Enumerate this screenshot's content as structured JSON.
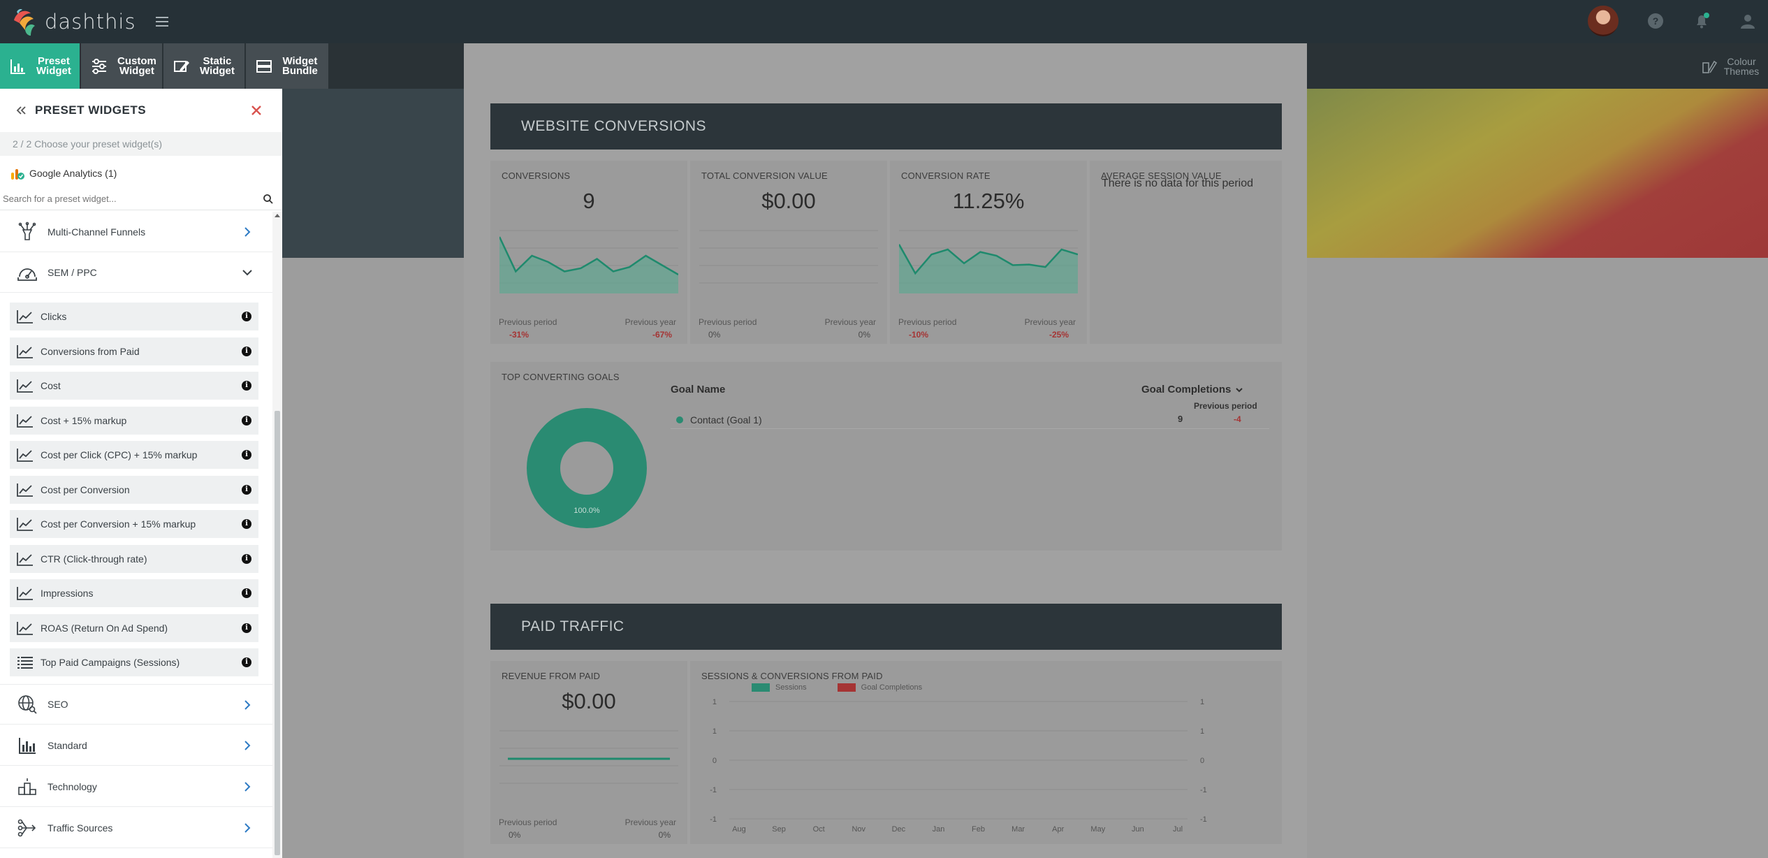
{
  "app": {
    "logo_text": "dashthis"
  },
  "toolbar": {
    "preset": {
      "line1": "Preset",
      "line2": "Widget"
    },
    "custom": {
      "line1": "Custom",
      "line2": "Widget"
    },
    "static": {
      "line1": "Static",
      "line2": "Widget"
    },
    "bundle": {
      "line1": "Widget",
      "line2": "Bundle"
    },
    "colour": {
      "line1": "Colour",
      "line2": "Themes"
    }
  },
  "panel": {
    "title": "PRESET WIDGETS",
    "step": "2 / 2   Choose your preset widget(s)",
    "source": "Google Analytics (1)",
    "search_placeholder": "Search for a preset widget...",
    "categories_top": [
      {
        "label": "Multi-Channel Funnels",
        "icon": "funnel-icon",
        "expanded": false
      },
      {
        "label": "SEM / PPC",
        "icon": "speedometer-icon",
        "expanded": true
      }
    ],
    "items": [
      {
        "label": "Clicks",
        "icon": "line-chart-icon"
      },
      {
        "label": "Conversions from Paid",
        "icon": "line-chart-icon"
      },
      {
        "label": "Cost",
        "icon": "line-chart-icon"
      },
      {
        "label": "Cost + 15% markup",
        "icon": "line-chart-icon"
      },
      {
        "label": "Cost per Click (CPC) + 15% markup",
        "icon": "line-chart-icon"
      },
      {
        "label": "Cost per Conversion",
        "icon": "line-chart-icon"
      },
      {
        "label": "Cost per Conversion + 15% markup",
        "icon": "line-chart-icon"
      },
      {
        "label": "CTR (Click-through rate)",
        "icon": "line-chart-icon"
      },
      {
        "label": "Impressions",
        "icon": "line-chart-icon"
      },
      {
        "label": "ROAS (Return On Ad Spend)",
        "icon": "line-chart-icon"
      },
      {
        "label": "Top Paid Campaigns (Sessions)",
        "icon": "list-icon"
      }
    ],
    "categories_bottom": [
      {
        "label": "SEO",
        "icon": "globe-search-icon"
      },
      {
        "label": "Standard",
        "icon": "bar-chart-icon"
      },
      {
        "label": "Technology",
        "icon": "podium-icon"
      },
      {
        "label": "Traffic Sources",
        "icon": "traffic-sources-icon"
      }
    ]
  },
  "website_conversions": {
    "header": "WEBSITE CONVERSIONS",
    "kpis": [
      {
        "title": "CONVERSIONS",
        "value": "9",
        "prev_period_label": "Previous period",
        "prev_period": "-31%",
        "prev_year_label": "Previous year",
        "prev_year": "-67%",
        "series": [
          0.9,
          0.35,
          0.6,
          0.5,
          0.35,
          0.4,
          0.55,
          0.35,
          0.42,
          0.6,
          0.45,
          0.3
        ]
      },
      {
        "title": "TOTAL CONVERSION VALUE",
        "value": "$0.00",
        "prev_period_label": "Previous period",
        "prev_period": "0%",
        "prev_year_label": "Previous year",
        "prev_year": "0%",
        "series": []
      },
      {
        "title": "CONVERSION RATE",
        "value": "11.25%",
        "prev_period_label": "Previous period",
        "prev_period": "-10%",
        "prev_year_label": "Previous year",
        "prev_year": "-25%",
        "series": [
          0.78,
          0.32,
          0.62,
          0.7,
          0.48,
          0.66,
          0.6,
          0.45,
          0.46,
          0.42,
          0.7,
          0.62
        ]
      },
      {
        "title": "AVERAGE SESSION VALUE",
        "message": "There is no data for this period"
      }
    ],
    "top_goals": {
      "title": "TOP CONVERTING GOALS",
      "col_goal": "Goal Name",
      "col_completions": "Goal Completions",
      "col_prev": "Previous period",
      "rows": [
        {
          "name": "Contact (Goal 1)",
          "value": "9",
          "prev": "-4"
        }
      ],
      "donut_label": "100.0%"
    }
  },
  "paid_traffic": {
    "header": "PAID TRAFFIC",
    "revenue": {
      "title": "REVENUE FROM PAID",
      "value": "$0.00",
      "prev_period_label": "Previous period",
      "prev_period": "0%",
      "prev_year_label": "Previous year",
      "prev_year": "0%"
    },
    "sessions_chart": {
      "title": "SESSIONS & CONVERSIONS FROM PAID",
      "legend": [
        "Sessions",
        "Goal Completions"
      ],
      "x_labels": [
        "Aug",
        "Sep",
        "Oct",
        "Nov",
        "Dec",
        "Jan",
        "Feb",
        "Mar",
        "Apr",
        "May",
        "Jun",
        "Jul"
      ],
      "y_left": [
        "1",
        "1",
        "0",
        "-1",
        "-1"
      ],
      "y_right": [
        "1",
        "1",
        "0",
        "-1",
        "-1"
      ]
    }
  },
  "colors": {
    "accent": "#2bb190",
    "dark": "#263137",
    "negative": "#a53434"
  }
}
